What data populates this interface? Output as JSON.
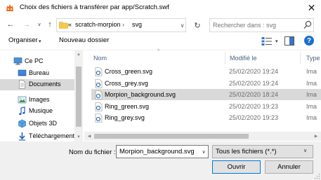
{
  "window": {
    "title": "Choix des fichiers à transférer par app/Scratch.swf",
    "close_glyph": "✕"
  },
  "address": {
    "back_glyph": "←",
    "forward_glyph": "→",
    "history_glyph": "∨",
    "up_glyph": "↑",
    "breadcrumb_prefix": "«",
    "crumbs": [
      "scratch-morpion",
      "svg"
    ],
    "crumb_separator": "›",
    "dropdown_glyph": "∨",
    "refresh_glyph": "↻"
  },
  "search": {
    "placeholder": "Rechercher dans : svg"
  },
  "toolbar": {
    "organise_label": "Organiser",
    "organise_dd": "▾",
    "new_folder_label": "Nouveau dossier",
    "view_dd": "▾",
    "help_label": "?"
  },
  "nav": {
    "items": [
      {
        "label": "Ce PC",
        "icon": "computer-icon"
      },
      {
        "label": "Bureau",
        "icon": "desktop-icon"
      },
      {
        "label": "Documents",
        "icon": "documents-icon",
        "selected": true
      },
      {
        "label": "Images",
        "icon": "images-icon"
      },
      {
        "label": "Musique",
        "icon": "music-icon"
      },
      {
        "label": "Objets 3D",
        "icon": "3d-objects-icon"
      },
      {
        "label": "Téléchargements",
        "icon": "downloads-icon"
      }
    ]
  },
  "list": {
    "columns": {
      "name": "Nom",
      "modified": "Modifié le",
      "type": "Type"
    },
    "sort_arrow": "^",
    "files": [
      {
        "name": "Cross_green.svg",
        "modified": "25/02/2020 19:24",
        "type": "Ima"
      },
      {
        "name": "Cross_grey.svg",
        "modified": "25/02/2020 19:24",
        "type": "Ima"
      },
      {
        "name": "Morpion_background.svg",
        "modified": "25/02/2020 18:24",
        "type": "Ima",
        "selected": true
      },
      {
        "name": "Ring_green.svg",
        "modified": "25/02/2020 19:23",
        "type": "Ima"
      },
      {
        "name": "Ring_grey.svg",
        "modified": "25/02/2020 19:23",
        "type": "Ima"
      }
    ]
  },
  "scroll": {
    "up": "▲",
    "down": "▼",
    "left": "◀",
    "right": "▶"
  },
  "bottom": {
    "filename_label": "Nom du fichier :",
    "filename_value": "Morpion_background.svg",
    "filename_dd": "∨",
    "filetype_label": "Tous les fichiers (*.*)",
    "filetype_dd": "∨",
    "open_label": "Ouvrir",
    "cancel_label": "Annuler"
  },
  "colors": {
    "accent": "#0078d7",
    "selection": "#d9d9d9",
    "column_header": "#4d6082"
  }
}
